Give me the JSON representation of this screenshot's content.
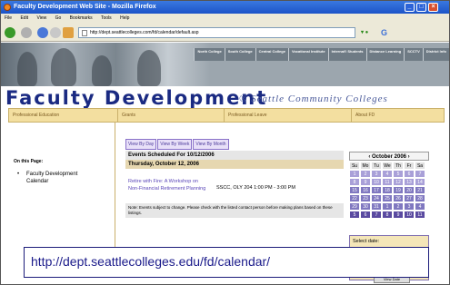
{
  "window": {
    "title": "Faculty Development Web Site - Mozilla Firefox"
  },
  "menu": [
    "File",
    "Edit",
    "View",
    "Go",
    "Bookmarks",
    "Tools",
    "Help"
  ],
  "address": {
    "url": "http://dept.seattlecolleges.com/fd/calendar/default.asp"
  },
  "college_nav": [
    "North College",
    "South College",
    "Central College",
    "Vocational Institute",
    "Internat'l Students",
    "Distance Learning",
    "SCCTV",
    "District Info"
  ],
  "site": {
    "title": "Faculty Development",
    "subtitle": "® Seattle Community Colleges"
  },
  "tabs": [
    "Professional Education",
    "Grants",
    "Professional Leave",
    "About FD"
  ],
  "sidebar": {
    "heading": "On this Page:",
    "link": "Faculty Development Calendar"
  },
  "views": [
    "View By Day",
    "View By Week",
    "View By Month"
  ],
  "events": {
    "heading": "Events Scheduled For 10/12/2006",
    "date": "Thursday, October 12, 2006",
    "event_title": "Retire with Fire: A Workshop on Non-Financial Retirement Planning",
    "event_location": "SSCC, OLY 204   1:00 PM - 3:00 PM",
    "note": "Note: Events subject to change. Please check with the listed contact person before making plans based on these listings."
  },
  "calendar": {
    "month": "‹  October 2006  ›",
    "dow": [
      "Su",
      "Mo",
      "Tu",
      "We",
      "Th",
      "Fr",
      "Sa"
    ],
    "days": [
      "1",
      "2",
      "3",
      "4",
      "5",
      "6",
      "7",
      "8",
      "9",
      "10",
      "11",
      "12",
      "13",
      "14",
      "15",
      "16",
      "17",
      "18",
      "19",
      "20",
      "21",
      "22",
      "23",
      "24",
      "25",
      "26",
      "27",
      "28",
      "29",
      "30",
      "31",
      "1",
      "2",
      "3",
      "4",
      "5",
      "6",
      "7",
      "8",
      "9",
      "10",
      "11"
    ]
  },
  "select_date": {
    "label": "Select date:",
    "button": "View Date"
  },
  "caption": "http://dept.seattlecolleges.edu/fd/calendar/"
}
